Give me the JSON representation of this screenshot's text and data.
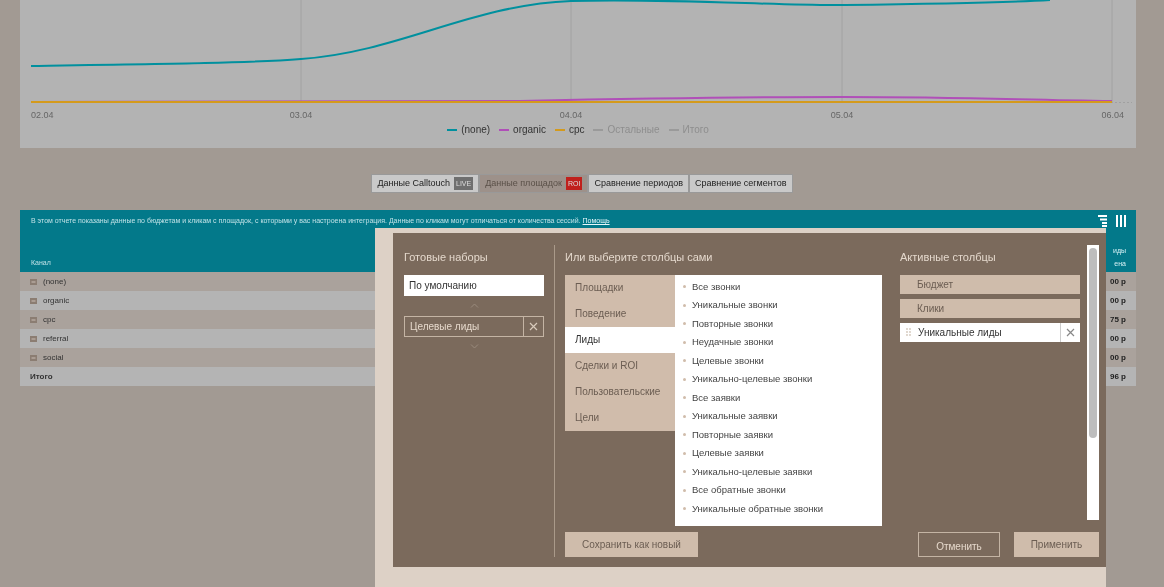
{
  "chart": {
    "x_labels": [
      "02.04",
      "03.04",
      "04.04",
      "05.04",
      "06.04"
    ],
    "legend": [
      {
        "label": "(none)",
        "color": "#00909e",
        "enabled": true
      },
      {
        "label": "organic",
        "color": "#b04fb8",
        "enabled": true
      },
      {
        "label": "cpc",
        "color": "#d49a1c",
        "enabled": true
      },
      {
        "label": "Остальные",
        "color": "#9a9a9a",
        "enabled": false
      },
      {
        "label": "Итого",
        "color": "#9a9a9a",
        "enabled": false
      }
    ]
  },
  "tabs": [
    {
      "label": "Данные Calltouch",
      "badge": {
        "text": "LIVE",
        "color": "#6f6f6f"
      },
      "selected": false
    },
    {
      "label": "Данные площадок",
      "badge": {
        "text": "ROI",
        "color": "#c0201c"
      },
      "selected": true
    },
    {
      "label": "Сравнение периодов",
      "selected": false
    },
    {
      "label": "Сравнение сегментов",
      "selected": false
    }
  ],
  "report": {
    "info": "В этом отчете показаны данные по бюджетам и кликам с площадок, с которыми у вас настроена интеграция. Данные по кликам могут отличаться от количества сессий.",
    "help_link": "Помощь",
    "columns": [
      {
        "label": "Канал"
      },
      {
        "lines": [
          "иды",
          "ена"
        ]
      }
    ],
    "rows": [
      {
        "name": "(none)",
        "value": "00 р",
        "expandable": true
      },
      {
        "name": "organic",
        "value": "00 р",
        "expandable": true
      },
      {
        "name": "cpc",
        "value": "75 р",
        "expandable": true
      },
      {
        "name": "referral",
        "value": "00 р",
        "expandable": true
      },
      {
        "name": "social",
        "value": "00 р",
        "expandable": true
      },
      {
        "name": "Итого",
        "value": "96 р",
        "expandable": false
      }
    ]
  },
  "column_picker": {
    "presets_title": "Готовые наборы",
    "presets": [
      {
        "label": "По умолчанию",
        "selected": true,
        "removable": false
      },
      {
        "label": "Целевые лиды",
        "selected": false,
        "removable": true
      }
    ],
    "choose_title": "Или выберите столбцы сами",
    "categories": [
      {
        "label": "Площадки",
        "selected": false
      },
      {
        "label": "Поведение",
        "selected": false
      },
      {
        "label": "Лиды",
        "selected": true
      },
      {
        "label": "Сделки и ROI",
        "selected": false
      },
      {
        "label": "Пользовательские",
        "selected": false
      },
      {
        "label": "Цели",
        "selected": false
      }
    ],
    "metrics": [
      "Все звонки",
      "Уникальные звонки",
      "Повторные звонки",
      "Неудачные звонки",
      "Целевые звонки",
      "Уникально-целевые звонки",
      "Все заявки",
      "Уникальные заявки",
      "Повторные заявки",
      "Целевые заявки",
      "Уникально-целевые заявки",
      "Все обратные звонки",
      "Уникальные обратные звонки"
    ],
    "active_title": "Активные столбцы",
    "active": [
      {
        "label": "Бюджет",
        "removable": false
      },
      {
        "label": "Клики",
        "removable": false
      },
      {
        "label": "Уникальные лиды",
        "removable": true
      }
    ],
    "save_button": "Сохранить как новый",
    "cancel_button": "Отменить",
    "apply_button": "Применить"
  }
}
